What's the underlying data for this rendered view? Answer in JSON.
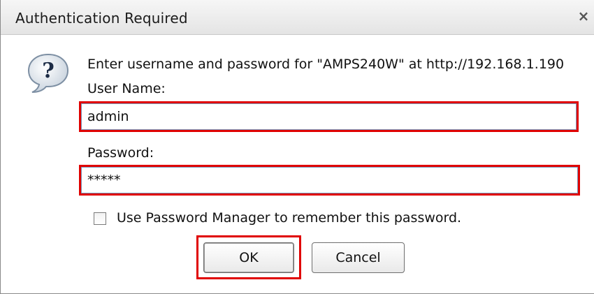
{
  "dialog": {
    "title": "Authentication Required",
    "close_symbol": "×",
    "prompt": "Enter username and password for \"AMPS240W\" at http://192.168.1.190",
    "icon": "question-icon"
  },
  "form": {
    "username_label": "User Name:",
    "username_value": "admin",
    "password_label": "Password:",
    "password_value": "*****",
    "remember_label": "Use Password Manager to remember this password.",
    "remember_checked": false
  },
  "buttons": {
    "ok_label": "OK",
    "cancel_label": "Cancel"
  },
  "colors": {
    "highlight": "#e00000",
    "titlebar": "#e9e9e9",
    "field_border": "#7a9cbf"
  }
}
